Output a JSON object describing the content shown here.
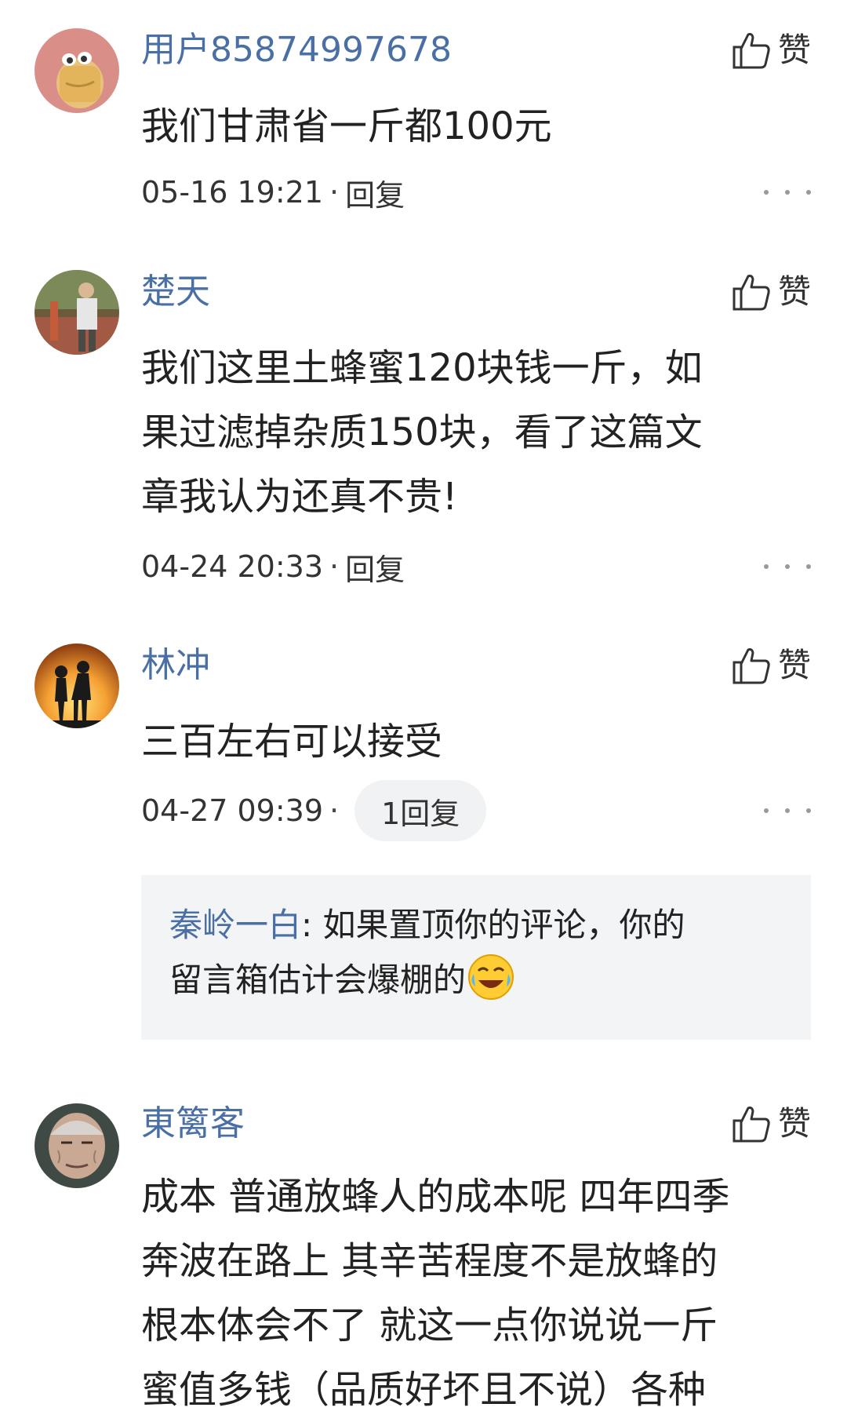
{
  "like_label": "赞",
  "comments": [
    {
      "username": "用户85874997678",
      "lines": [
        "我们甘肃省一斤都100元"
      ],
      "time": "05-16 19:21",
      "sep": "·",
      "reply": "回复",
      "avatar_icon": "cartoon-avatar-icon"
    },
    {
      "username": "楚天",
      "lines": [
        "我们这里土蜂蜜120块钱一斤，如",
        "果过滤掉杂质150块，看了这篇文",
        "章我认为还真不贵!"
      ],
      "time": "04-24 20:33",
      "sep": "·",
      "reply": "回复",
      "avatar_icon": "photo-avatar-icon"
    },
    {
      "username": "林冲",
      "lines": [
        "三百左右可以接受"
      ],
      "time": "04-27 09:39",
      "sep": "·",
      "reply": "1回复",
      "sub_reply": {
        "author": "秦岭一白",
        "colon": ":",
        "lines": [
          " 如果置顶你的评论，你的",
          "留言箱估计会爆棚的"
        ],
        "emoji": "laughing-crying-emoji"
      },
      "avatar_icon": "sunset-silhouette-avatar-icon"
    },
    {
      "username": "東篱客",
      "lines": [
        "成本 普通放蜂人的成本呢 四年四季",
        "奔波在路上 其辛苦程度不是放蜂的",
        "根本体会不了 就这一点你说说一斤",
        "蜜值多钱（品质好坏且不说）各种"
      ],
      "avatar_icon": "elderly-man-avatar-icon"
    }
  ],
  "colors": {
    "username": "#4a6fa5",
    "text": "#222222",
    "meta": "#333333",
    "sub_box_bg": "#f3f4f6",
    "more_dots": "#999999"
  }
}
